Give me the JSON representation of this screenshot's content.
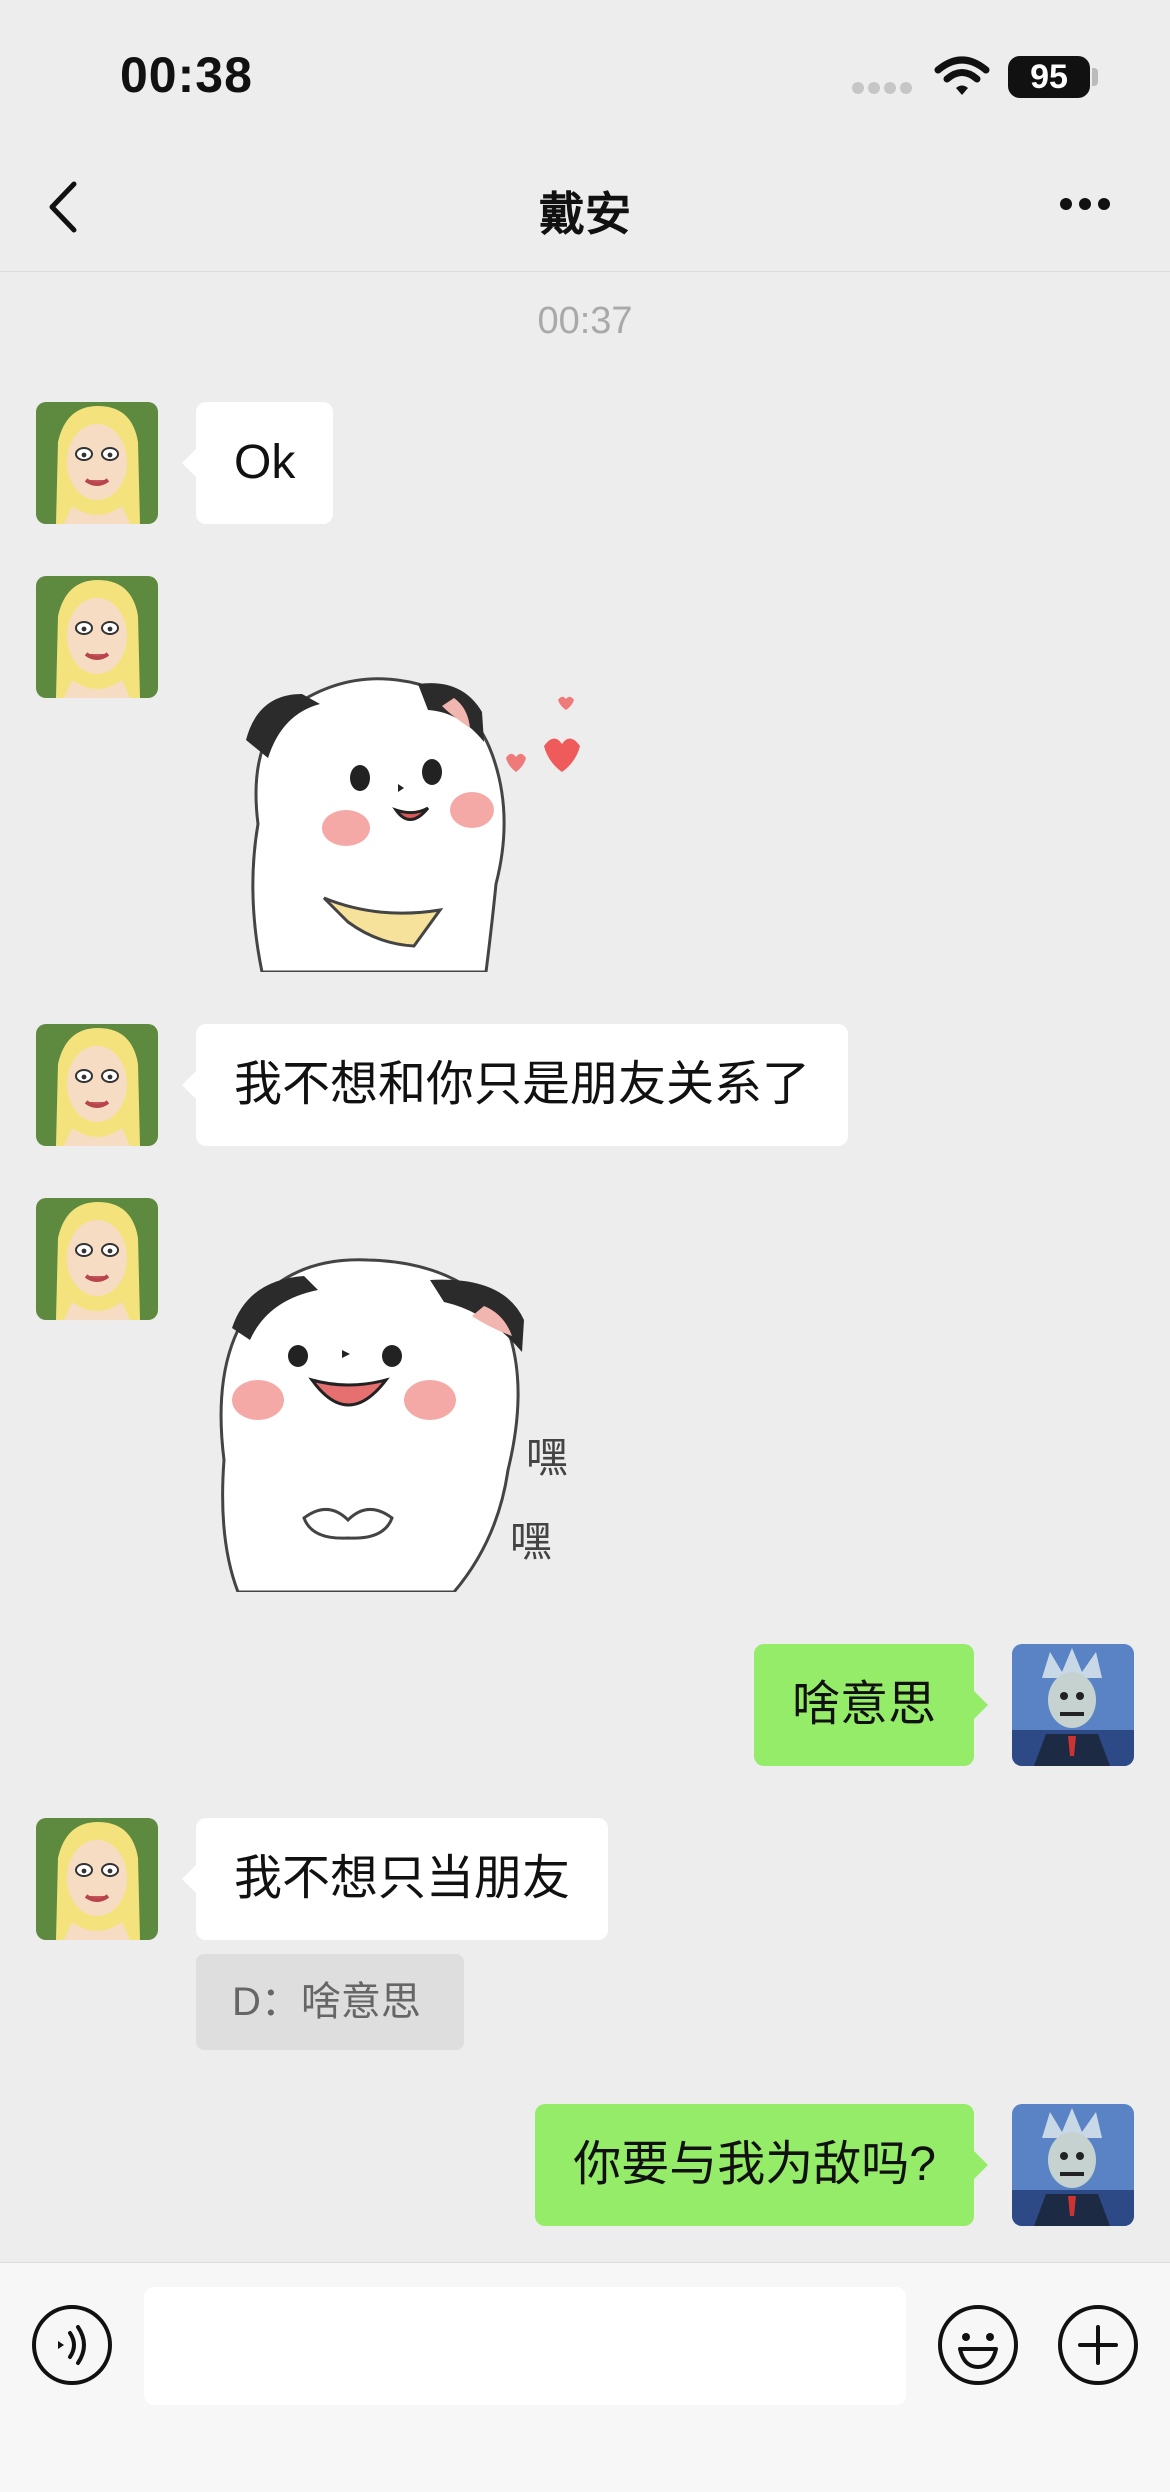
{
  "status_bar": {
    "time": "00:38",
    "battery": "95"
  },
  "nav": {
    "title": "戴安"
  },
  "timestamp": "00:37",
  "messages": [
    {
      "side": "in",
      "text": "Ok"
    },
    {
      "side": "in",
      "sticker": "puppy-hearts-sticker"
    },
    {
      "side": "in",
      "text": "我不想和你只是朋友关系了"
    },
    {
      "side": "in",
      "sticker": "puppy-laughing-sticker",
      "sticker_text": [
        "嘿",
        "嘿"
      ]
    },
    {
      "side": "out",
      "text": "啥意思"
    },
    {
      "side": "in",
      "text": "我不想只当朋友",
      "quote": "D：啥意思"
    },
    {
      "side": "out",
      "text": "你要与我为敌吗?"
    }
  ],
  "colors": {
    "background": "#ededed",
    "incoming_bubble": "#ffffff",
    "outgoing_bubble": "#95ec69",
    "input_bar": "#f7f7f7"
  },
  "input": {
    "value": "",
    "placeholder": ""
  },
  "icons": {
    "back": "chevron-left-icon",
    "more": "more-dots-icon",
    "voice": "voice-icon",
    "emoji": "emoji-icon",
    "plus": "plus-icon"
  }
}
